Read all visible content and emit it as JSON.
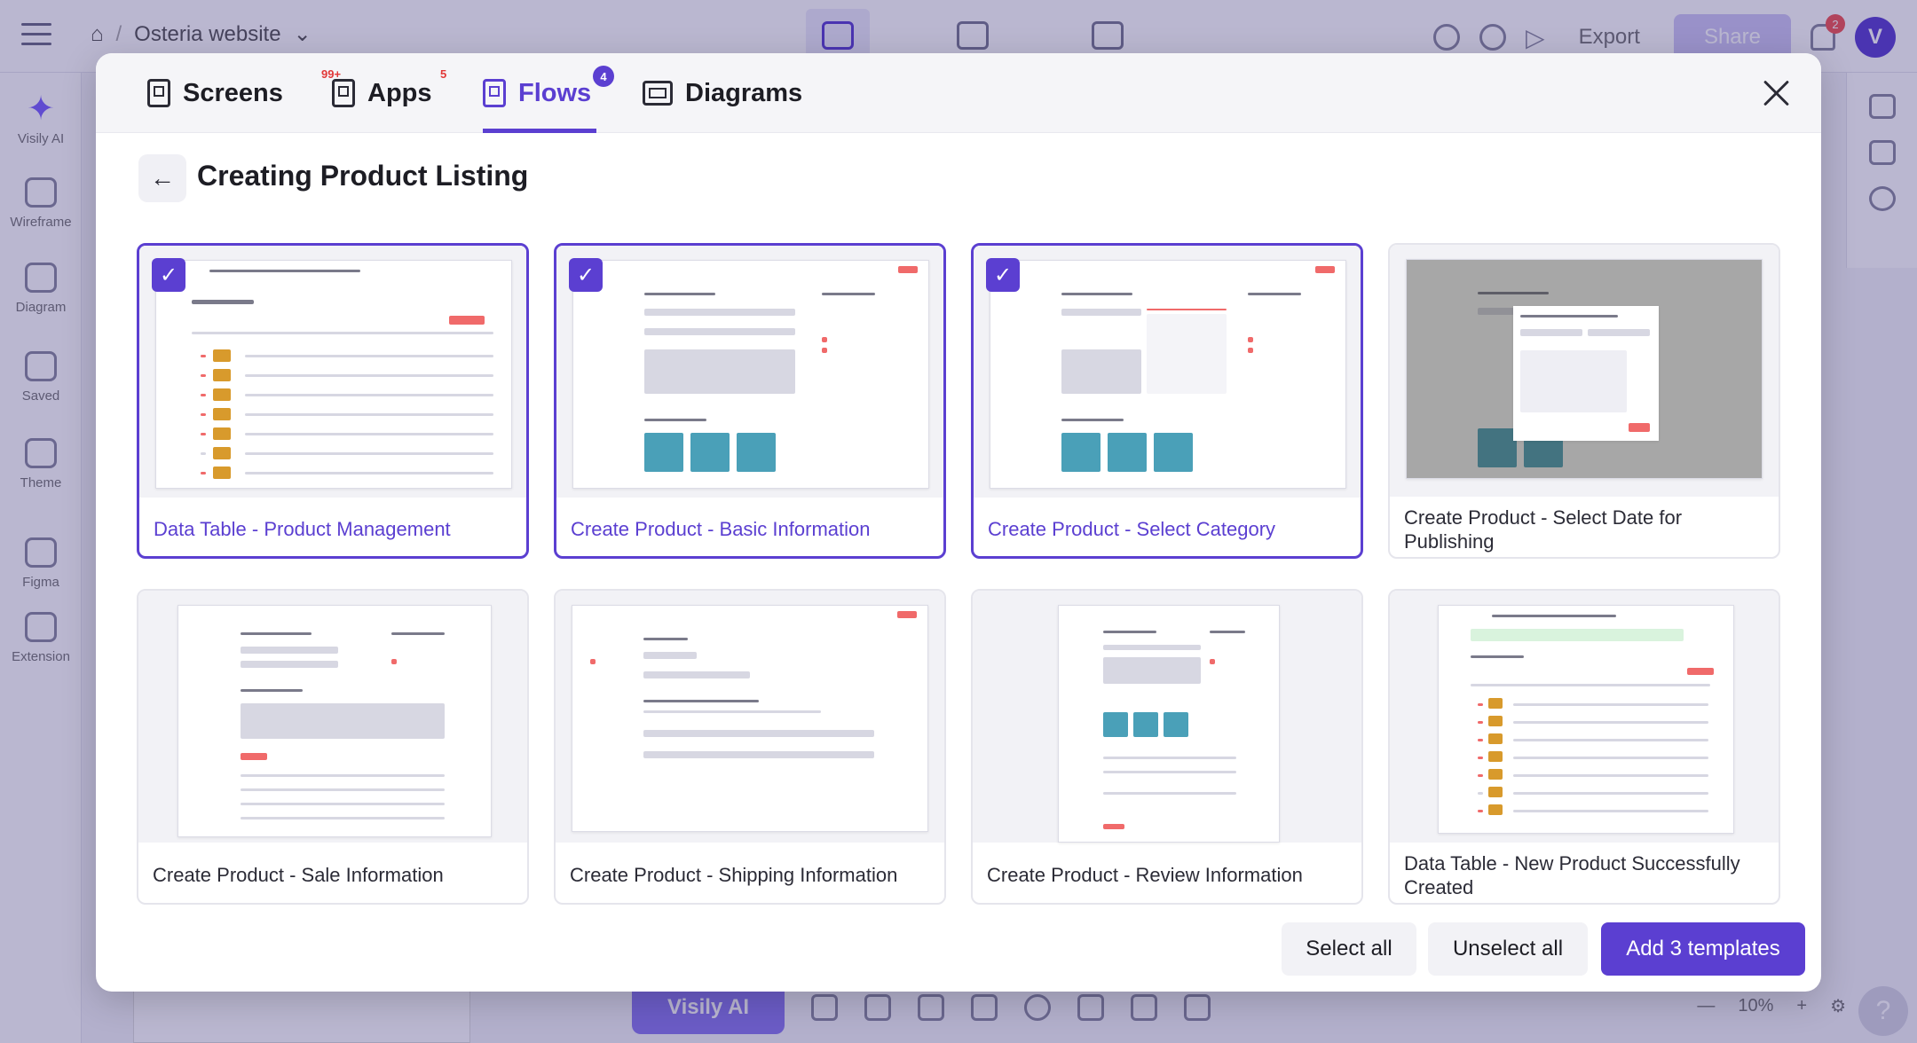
{
  "app": {
    "project_name": "Osteria website",
    "export_label": "Export",
    "share_label": "Share",
    "notification_count": "2",
    "avatar_letter": "V",
    "zoom_level": "10%",
    "visly_ai_label": "Visily AI",
    "left_nav": [
      {
        "label": "Visily AI"
      },
      {
        "label": "Wireframe"
      },
      {
        "label": "Diagram"
      },
      {
        "label": "Saved"
      },
      {
        "label": "Theme"
      },
      {
        "label": "Figma"
      },
      {
        "label": "Extension"
      }
    ],
    "colors": {
      "accent": "#5b3fd1",
      "danger": "#f06a6a"
    }
  },
  "modal": {
    "tabs": [
      {
        "label": "Screens",
        "badge": "99+",
        "icon": "screen-icon"
      },
      {
        "label": "Apps",
        "badge": "5",
        "icon": "apps-icon"
      },
      {
        "label": "Flows",
        "badge": "4",
        "icon": "flows-icon"
      },
      {
        "label": "Diagrams",
        "badge": "",
        "icon": "diagram-icon"
      }
    ],
    "title": "Creating Product Listing",
    "cards": [
      {
        "caption": "Data Table - Product Management",
        "selected": true
      },
      {
        "caption": "Create Product - Basic Information",
        "selected": true
      },
      {
        "caption": "Create Product - Select Category",
        "selected": true
      },
      {
        "caption": "Create Product - Select Date for Publishing",
        "selected": false
      },
      {
        "caption": "Create Product - Sale Information",
        "selected": false
      },
      {
        "caption": "Create Product - Shipping Information",
        "selected": false
      },
      {
        "caption": "Create Product - Review Information",
        "selected": false
      },
      {
        "caption": "Data Table - New Product Successfully Created",
        "selected": false
      }
    ],
    "buttons": {
      "select_all": "Select all",
      "unselect_all": "Unselect all",
      "add": "Add 3 templates"
    }
  }
}
